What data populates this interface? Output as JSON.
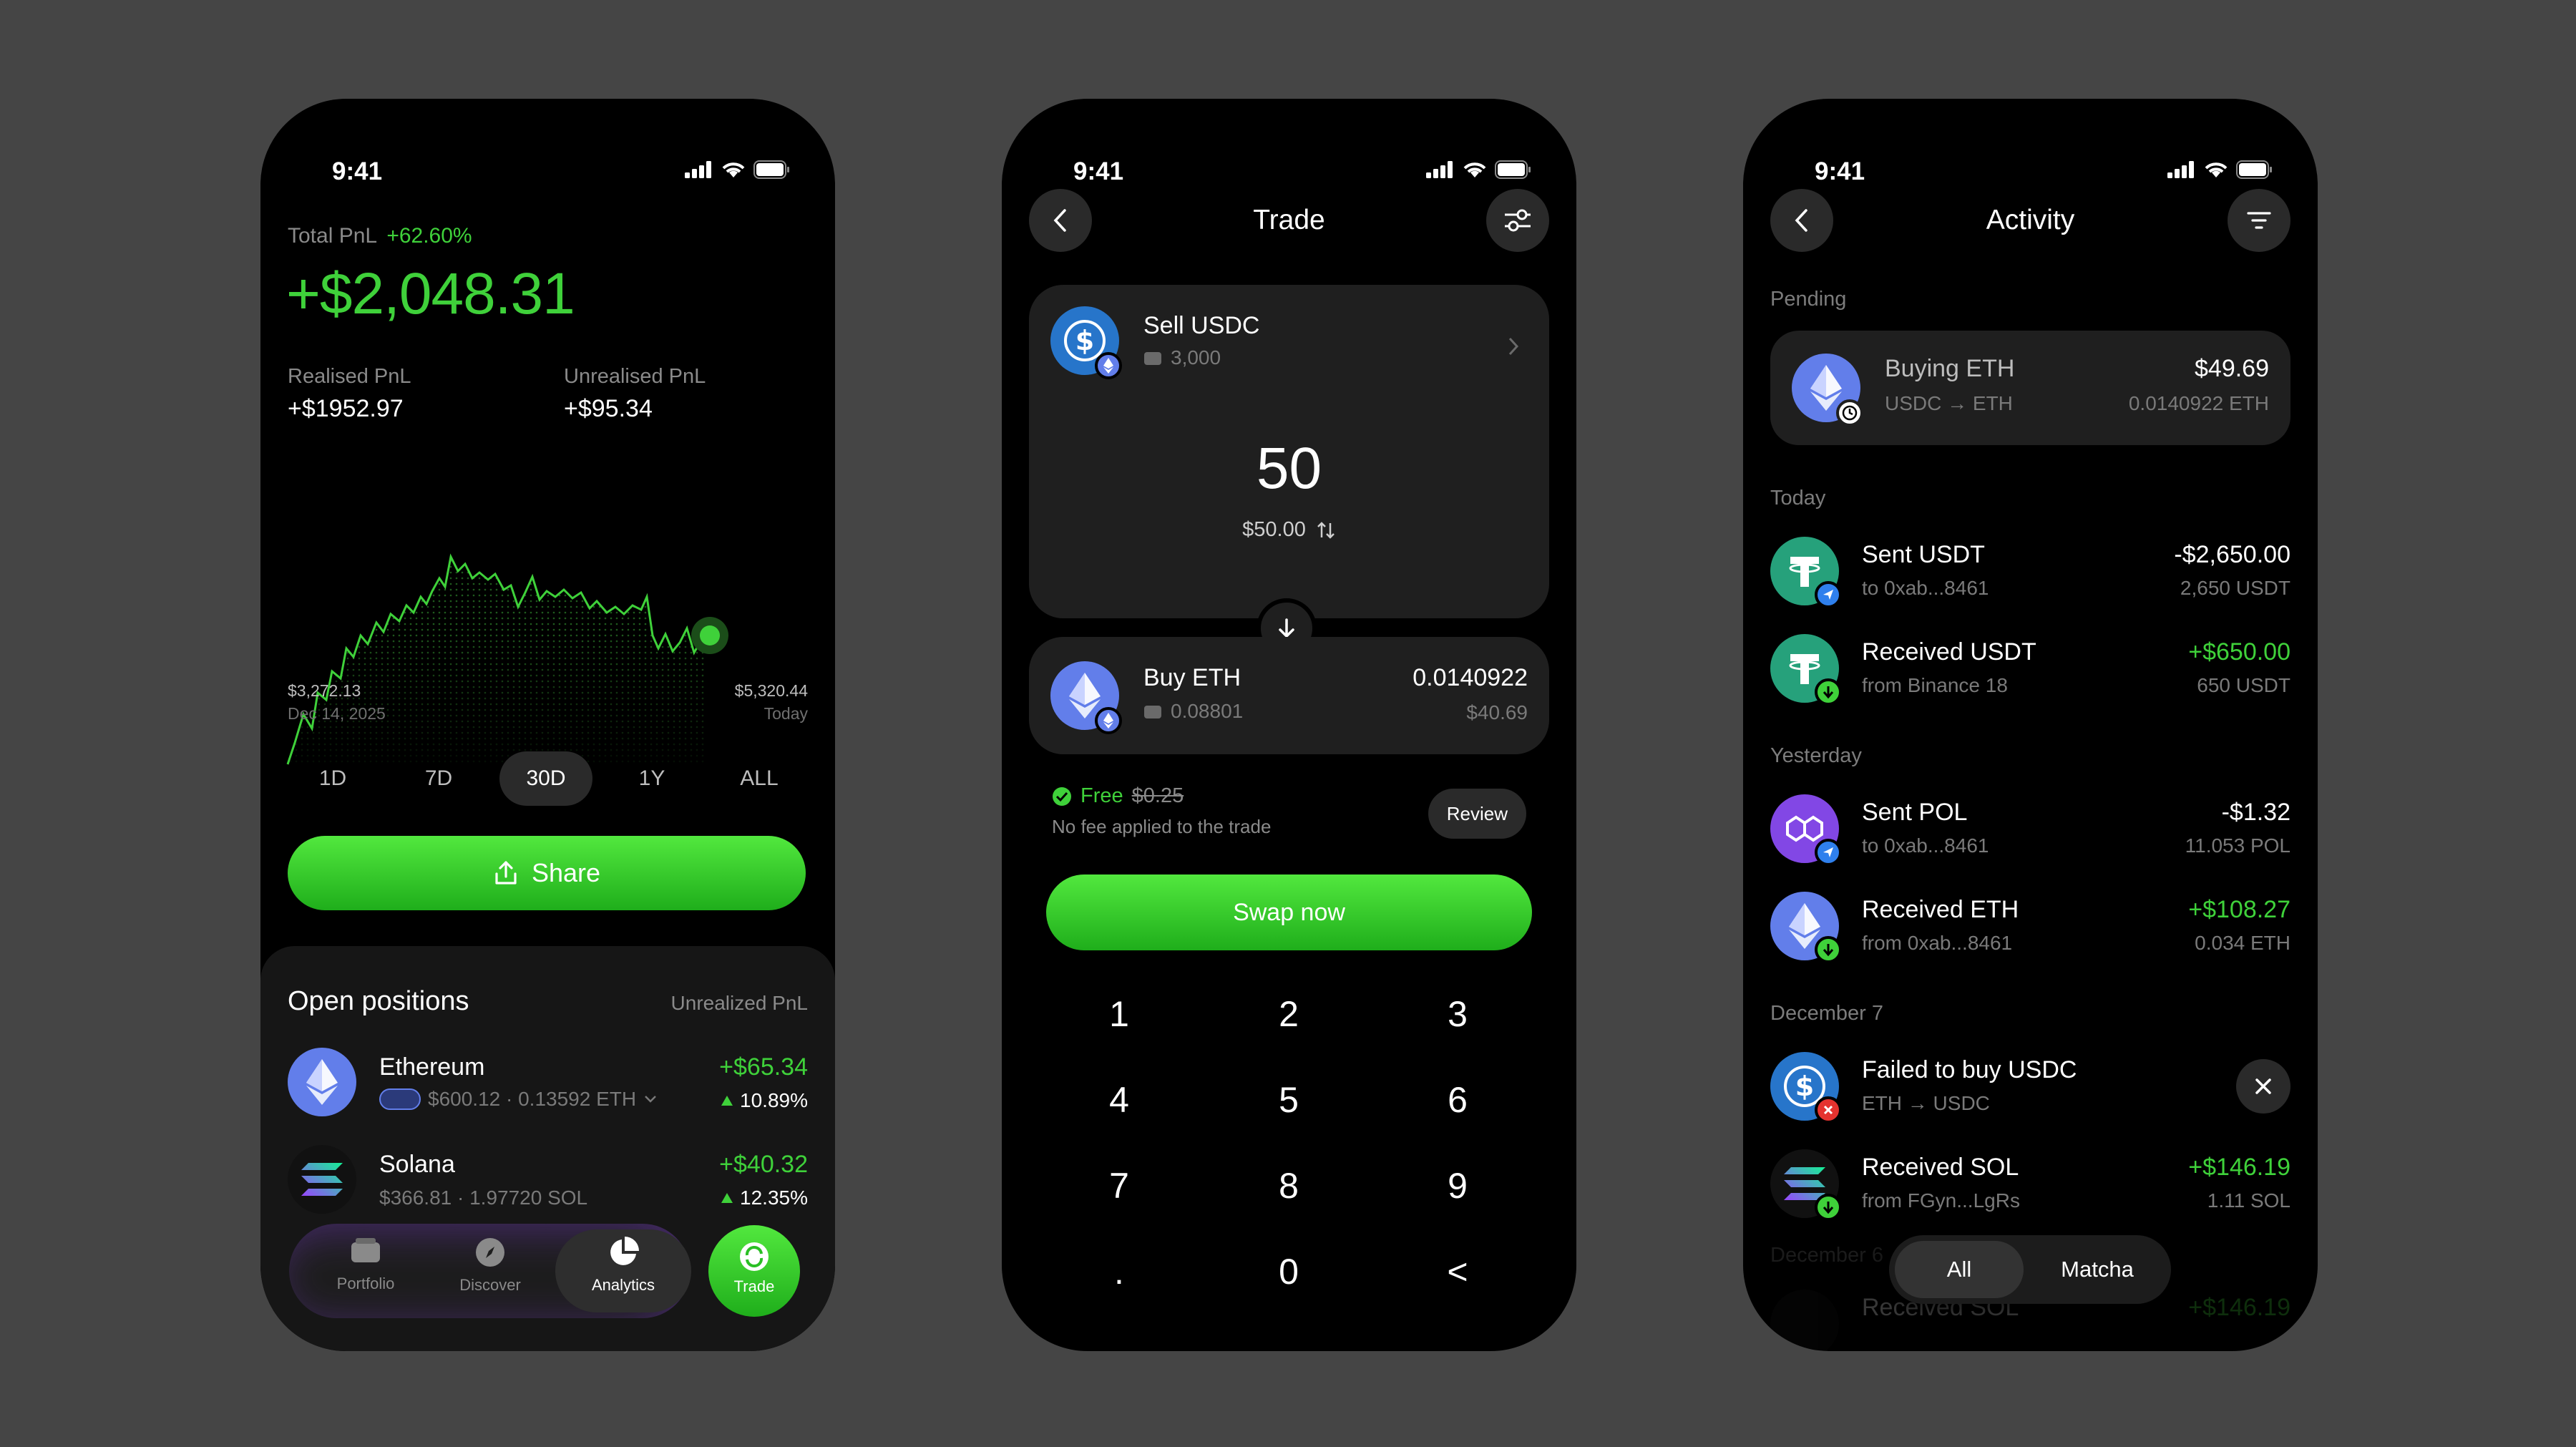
{
  "status_time": "9:41",
  "colors": {
    "accent_green": "#3fd13a",
    "negative_red": "#e5332f",
    "eth_blue": "#627eea",
    "usdc_blue": "#2775ca",
    "usdt_teal": "#26a17b",
    "pol_purple": "#8247e5"
  },
  "analytics": {
    "total_label": "Total PnL",
    "total_pct": "+62.60%",
    "total_value": "+$2,048.31",
    "realised_label": "Realised PnL",
    "realised_value": "+$1952.97",
    "unrealised_label": "Unrealised PnL",
    "unrealised_value": "+$95.34",
    "min_price": "$3,272.13",
    "min_date": "Dec 14, 2025",
    "max_price": "$5,320.44",
    "max_date": "Today",
    "ranges": [
      "1D",
      "7D",
      "30D",
      "1Y",
      "ALL"
    ],
    "active_range": "30D",
    "share_label": "Share",
    "positions_title": "Open positions",
    "positions_col": "Unrealized PnL",
    "positions": [
      {
        "name": "Ethereum",
        "detail": "$600.12 · 0.13592 ETH",
        "pnl": "+$65.34",
        "pct": "10.89%",
        "icon": "eth-icon"
      },
      {
        "name": "Solana",
        "detail": "$366.81 · 1.97720 SOL",
        "pnl": "+$40.32",
        "pct": "12.35%",
        "icon": "sol-icon"
      }
    ],
    "tabbar": [
      {
        "label": "Portfolio",
        "icon": "wallet-icon"
      },
      {
        "label": "Discover",
        "icon": "compass-icon"
      },
      {
        "label": "Analytics",
        "icon": "pie-chart-icon"
      },
      {
        "label": "Trade",
        "icon": "swap-icon"
      }
    ]
  },
  "trade": {
    "title": "Trade",
    "sell_title": "Sell USDC",
    "sell_balance": "3,000",
    "amount": "50",
    "amount_usd": "$50.00",
    "buy_title": "Buy ETH",
    "buy_balance": "0.08801",
    "buy_amount": "0.0140922",
    "buy_usd": "$40.69",
    "fee_label": "Free",
    "fee_old": "$0.25",
    "fee_note": "No fee applied to the trade",
    "review_label": "Review",
    "swap_label": "Swap now",
    "keys": [
      "1",
      "2",
      "3",
      "4",
      "5",
      "6",
      "7",
      "8",
      "9",
      ".",
      "0",
      "<"
    ]
  },
  "activity": {
    "title": "Activity",
    "pending_label": "Pending",
    "pending": {
      "title": "Buying ETH",
      "sub": "USDC → ETH",
      "amount": "$49.69",
      "detail": "0.0140922 ETH"
    },
    "today_label": "Today",
    "yesterday_label": "Yesterday",
    "dec7_label": "December 7",
    "dec6_label": "December 6",
    "items": [
      {
        "title": "Sent USDT",
        "sub": "to 0xab...8461",
        "amount": "-$2,650.00",
        "detail": "2,650 USDT"
      },
      {
        "title": "Received USDT",
        "sub": "from Binance 18",
        "amount": "+$650.00",
        "detail": "650 USDT"
      },
      {
        "title": "Sent POL",
        "sub": "to 0xab...8461",
        "amount": "-$1.32",
        "detail": "11.053 POL"
      },
      {
        "title": "Received ETH",
        "sub": "from 0xab...8461",
        "amount": "+$108.27",
        "detail": "0.034 ETH"
      },
      {
        "title": "Failed to buy USDC",
        "sub": "ETH → USDC"
      },
      {
        "title": "Received SOL",
        "sub": "from FGyn...LgRs",
        "amount": "+$146.19",
        "detail": "1.11 SOL"
      },
      {
        "title": "Received SOL",
        "amount": "+$146.19"
      }
    ],
    "segments": [
      "All",
      "Matcha"
    ],
    "active_segment": "All"
  }
}
